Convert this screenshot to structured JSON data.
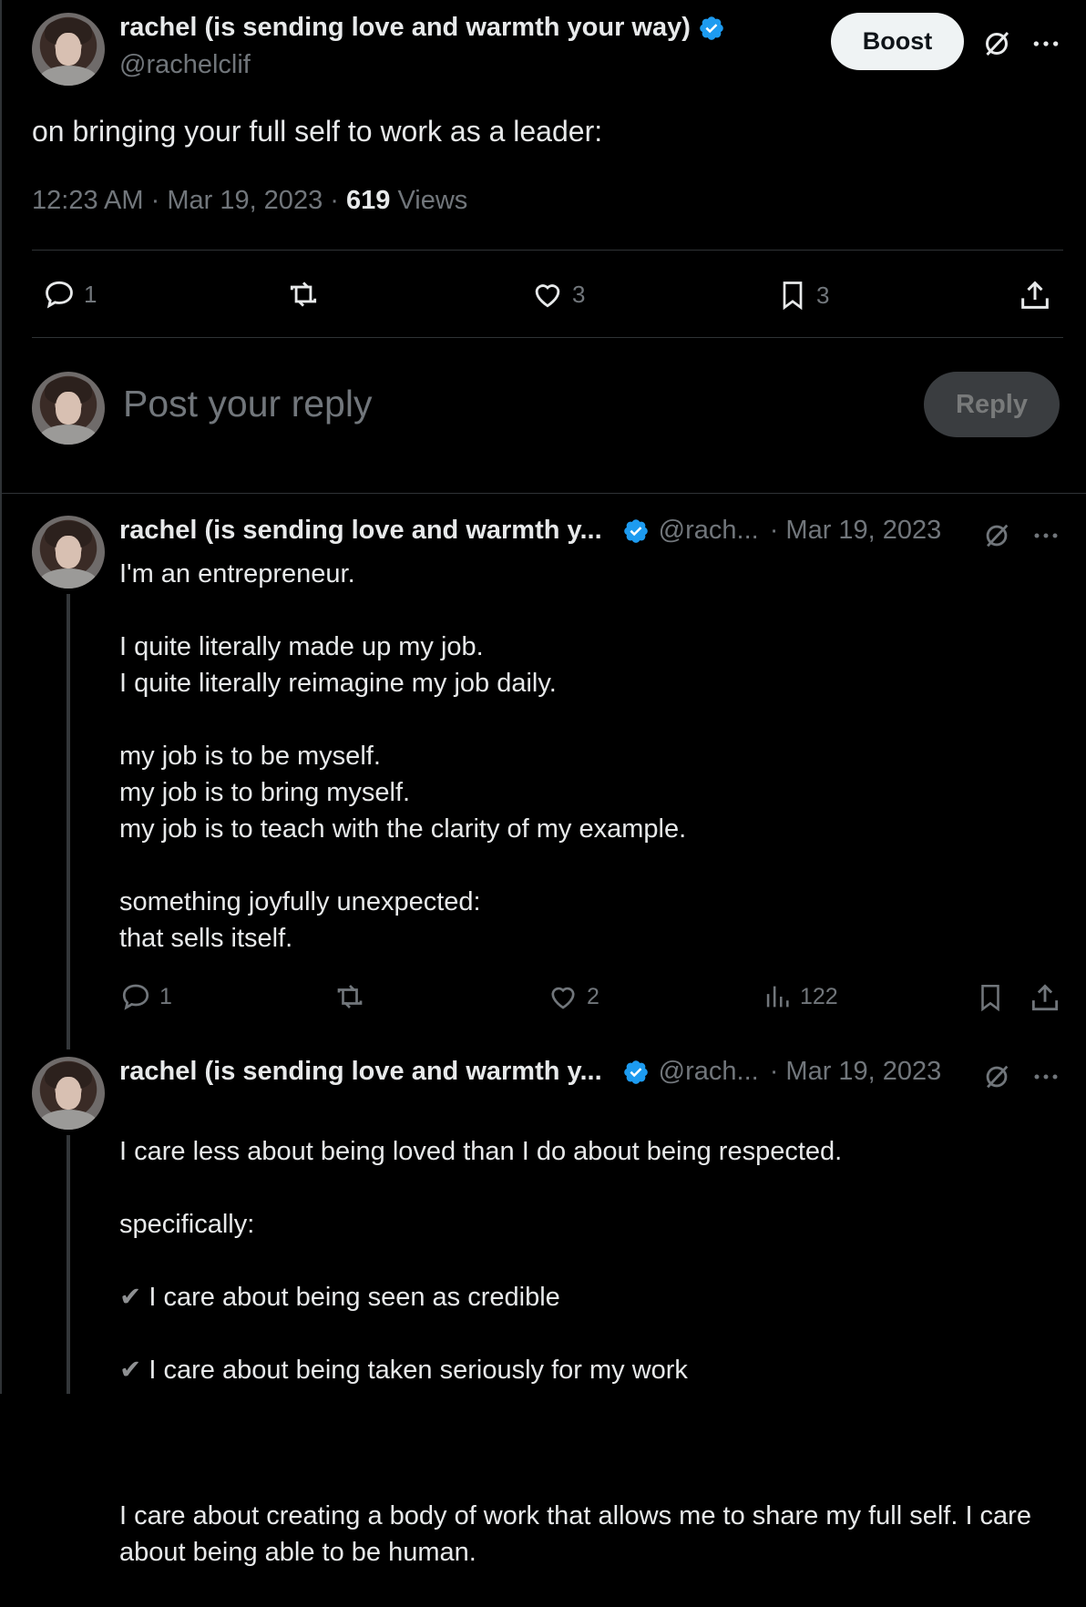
{
  "main_post": {
    "author_name": "rachel (is sending love and warmth your way)",
    "handle": "@rachelclif",
    "boost_label": "Boost",
    "text": "on bringing your full self to work as a leader:",
    "time": "12:23 AM",
    "date": "Mar 19, 2023",
    "views_count": "619",
    "views_label": "Views",
    "actions": {
      "replies": "1",
      "likes": "3",
      "bookmarks": "3"
    }
  },
  "composer": {
    "placeholder": "Post your reply",
    "reply_label": "Reply"
  },
  "replies": [
    {
      "author_name": "rachel (is sending love and warmth y...",
      "handle": "@rach...",
      "date": "· Mar 19, 2023",
      "text": "I'm an entrepreneur.\n\nI quite literally made up my job.\nI quite literally reimagine my job daily.\n\nmy job is to be myself.\nmy job is to bring myself.\nmy job is to teach with the clarity of my example.\n\nsomething joyfully unexpected:\nthat sells itself.",
      "actions": {
        "replies": "1",
        "likes": "2",
        "views": "122"
      }
    },
    {
      "author_name": "rachel (is sending love and warmth y...",
      "handle": "@rach...",
      "date": "· Mar 19, 2023",
      "text_intro": "I care less about being loved than I do about being respected.\n\nspecifically:",
      "checks": [
        "I care about being seen as credible",
        "I care about being taken seriously for my work"
      ],
      "check_glyph": "✔",
      "text_outro": "I care about creating a body of work that allows me to share my full self. I care about being able to be human."
    }
  ],
  "colors": {
    "background": "#000000",
    "text": "#e7e9ea",
    "muted": "#71767b",
    "verified": "#1d9bf0",
    "divider": "#2f3336"
  }
}
